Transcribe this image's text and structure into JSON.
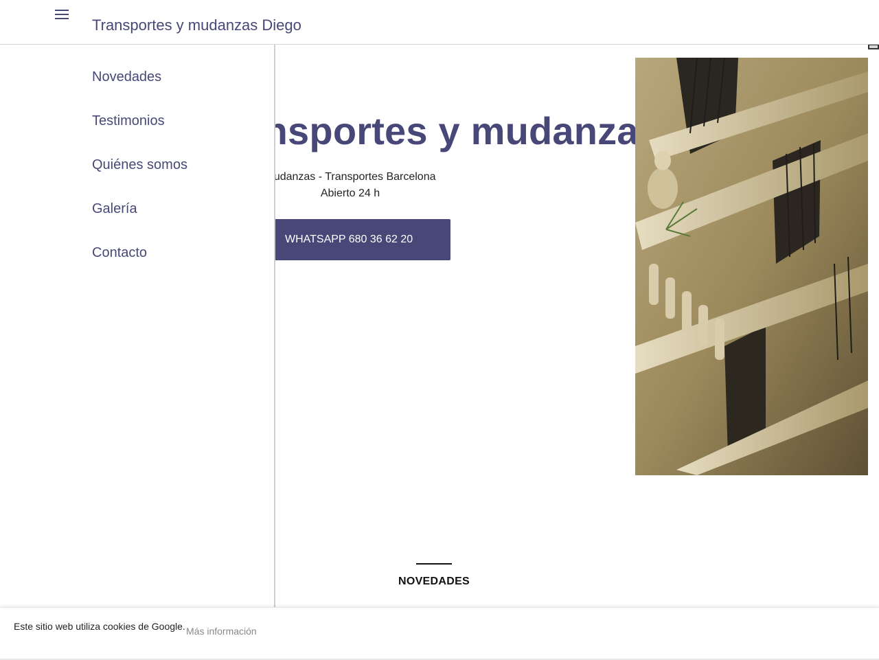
{
  "header": {
    "site_title": "Transportes y mudanzas Diego",
    "menu_icon": "menu-icon"
  },
  "drawer": {
    "items": [
      {
        "label": "Novedades"
      },
      {
        "label": "Testimonios"
      },
      {
        "label": "Quiénes somos"
      },
      {
        "label": "Galería"
      },
      {
        "label": "Contacto"
      }
    ]
  },
  "hero": {
    "title": "Transportes y mudanzas Diego",
    "subtitle_line1": "Mudanzas - Transportes Barcelona",
    "subtitle_line2": "Abierto 24 h",
    "cta_label": "WHATSAPP 680 36 62 20",
    "image_alt": "building-balconies-photo"
  },
  "sections": {
    "novedades_heading": "NOVEDADES"
  },
  "cookie_bar": {
    "text": "Este sitio web utiliza cookies de Google.",
    "link": "Más información"
  },
  "colors": {
    "brand": "#484878",
    "text": "#222222",
    "muted_link": "#888888"
  }
}
